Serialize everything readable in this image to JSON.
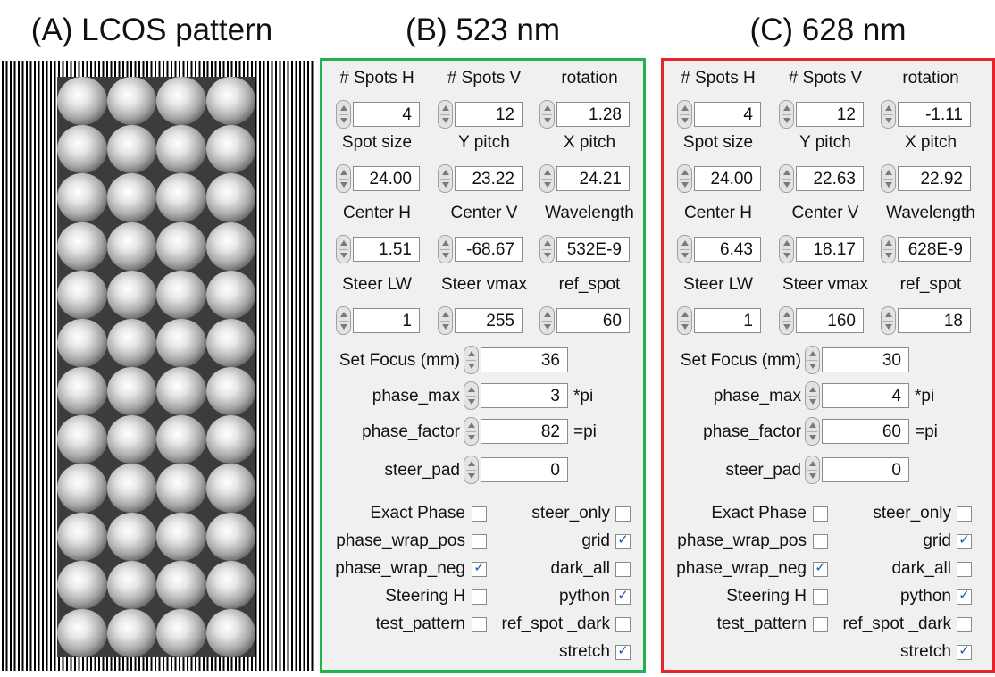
{
  "headings": {
    "a": "(A) LCOS pattern",
    "b": "(B) 523 nm",
    "c": "(C) 628 nm"
  },
  "lcos_pattern": {
    "columns": 4,
    "rows": 12
  },
  "colors": {
    "panel_b_border": "#22b14c",
    "panel_c_border": "#e8232a",
    "panel_bg": "#f0f0f0",
    "check": "#2855b8"
  },
  "icons": {
    "spinner": "up-down-spinner-icon",
    "checkbox": "checkbox-icon",
    "checkmark": "checkmark-icon"
  },
  "labels": {
    "spots_h": "# Spots H",
    "spots_v": "# Spots V",
    "rotation": "rotation",
    "spot_size": "Spot size",
    "y_pitch": "Y pitch",
    "x_pitch": "X pitch",
    "center_h": "Center H",
    "center_v": "Center V",
    "wavelength": "Wavelength",
    "steer_lw": "Steer LW",
    "steer_vmax": "Steer vmax",
    "ref_spot": "ref_spot",
    "set_focus": "Set Focus (mm)",
    "phase_max": "phase_max",
    "phase_factor": "phase_factor",
    "steer_pad": "steer_pad",
    "pi_unit": "*pi",
    "eq_pi": "=pi",
    "exact_phase": "Exact Phase",
    "phase_wrap_pos": "phase_wrap_pos",
    "phase_wrap_neg": "phase_wrap_neg",
    "steering_h": "Steering H",
    "test_pattern": "test_pattern",
    "steer_only": "steer_only",
    "grid": "grid",
    "dark_all": "dark_all",
    "python": "python",
    "ref_spot_dark": "ref_spot _dark",
    "stretch": "stretch"
  },
  "panel_b": {
    "values": {
      "spots_h": "4",
      "spots_v": "12",
      "rotation": "1.28",
      "spot_size": "24.00",
      "y_pitch": "23.22",
      "x_pitch": "24.21",
      "center_h": "1.51",
      "center_v": "-68.67",
      "wavelength": "532E-9",
      "steer_lw": "1",
      "steer_vmax": "255",
      "ref_spot": "60",
      "set_focus": "36",
      "phase_max": "3",
      "phase_factor": "82",
      "steer_pad": "0"
    },
    "checks": {
      "exact_phase": false,
      "phase_wrap_pos": false,
      "phase_wrap_neg": true,
      "steering_h": false,
      "test_pattern": false,
      "steer_only": false,
      "grid": true,
      "dark_all": false,
      "python": true,
      "ref_spot_dark": false,
      "stretch": true
    }
  },
  "panel_c": {
    "values": {
      "spots_h": "4",
      "spots_v": "12",
      "rotation": "-1.11",
      "spot_size": "24.00",
      "y_pitch": "22.63",
      "x_pitch": "22.92",
      "center_h": "6.43",
      "center_v": "18.17",
      "wavelength": "628E-9",
      "steer_lw": "1",
      "steer_vmax": "160",
      "ref_spot": "18",
      "set_focus": "30",
      "phase_max": "4",
      "phase_factor": "60",
      "steer_pad": "0"
    },
    "checks": {
      "exact_phase": false,
      "phase_wrap_pos": false,
      "phase_wrap_neg": true,
      "steering_h": false,
      "test_pattern": false,
      "steer_only": false,
      "grid": true,
      "dark_all": false,
      "python": true,
      "ref_spot_dark": false,
      "stretch": true
    }
  }
}
